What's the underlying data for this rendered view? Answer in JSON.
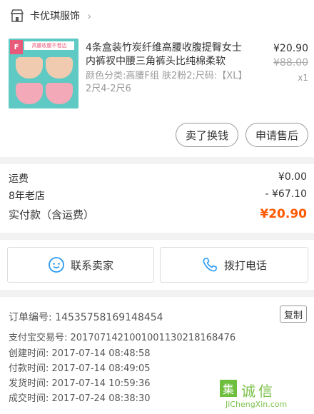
{
  "store": {
    "name": "卡优琪服饰",
    "chevron": "›"
  },
  "product": {
    "thumb_tag": "F",
    "thumb_caption": "高腰收腹不卷边",
    "title": "4条盒装竹炭纤维高腰收腹提臀女士内裤衩中腰三角裤头比纯棉柔软",
    "spec": "颜色分类:高腰F组 肤2粉2;尺码:【XL】2尺4-2尺6",
    "price": "¥20.90",
    "original_price": "¥88.00",
    "quantity": "x1"
  },
  "after_sale": {
    "refund_label": "卖了换钱",
    "after_sale_label": "申请售后"
  },
  "summary": {
    "shipping_label": "运费",
    "shipping_value": "¥0.00",
    "discount_label": "8年老店",
    "discount_value": "- ¥67.10",
    "total_label": "实付款（含运费）",
    "total_value": "¥20.90"
  },
  "contact": {
    "chat_label": "联系卖家",
    "phone_label": "拨打电话"
  },
  "order_info": {
    "order_no": "订单编号: 14535758169148454",
    "alipay_no": "支付宝交易号: 2017071421001001130218168476",
    "created": "创建时间: 2017-07-14 08:48:58",
    "paid": "付款时间: 2017-07-14 08:49:05",
    "shipped": "发货时间: 2017-07-14 10:59:36",
    "completed": "成交时间: 2017-07-24 08:38:30",
    "copy_label": "复制"
  },
  "watermark": {
    "mark": "集",
    "chars": "诚信",
    "url": "JiChengXin.com"
  },
  "colors": {
    "accent": "#ff5a00",
    "thumb_bg": "#5fc9c3",
    "watermark": "#7cc24a"
  }
}
